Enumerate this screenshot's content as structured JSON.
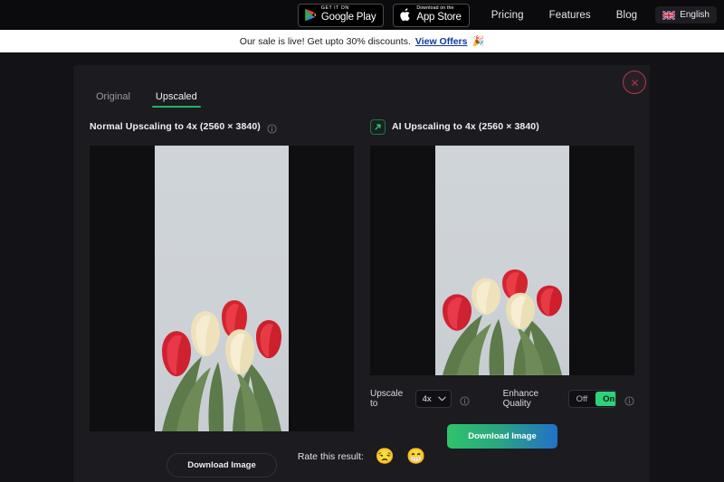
{
  "topnav": {
    "google_play": {
      "small_label": "GET IT ON",
      "main_label": "Google Play",
      "icon": "google-play-icon"
    },
    "app_store": {
      "small_label": "Download on the",
      "main_label": "App Store",
      "icon": "apple-icon"
    },
    "links": [
      {
        "label": "Pricing"
      },
      {
        "label": "Features"
      },
      {
        "label": "Blog"
      }
    ],
    "language": {
      "label": "English",
      "icon": "uk-flag-icon"
    }
  },
  "banner": {
    "text": "Our sale is live! Get upto 30% discounts.",
    "link_label": "View Offers",
    "emoji": "🎉",
    "background": "#ffffff",
    "link_color": "#10379b"
  },
  "modal": {
    "close_icon": "close-icon",
    "close_color": "#b03a54",
    "tabs": [
      {
        "label": "Original",
        "active": false
      },
      {
        "label": "Upscaled",
        "active": true
      }
    ],
    "active_tab_color": "#21b366",
    "left_panel": {
      "title": "Normal Upscaling to 4x (2560 × 3840)",
      "info_icon": "info-icon",
      "download_label": "Download Image"
    },
    "right_panel": {
      "title": "AI Upscaling to 4x (2560 × 3840)",
      "badge_icon": "expand-arrow-icon",
      "info_icon": "info-icon",
      "download_label": "Download Image",
      "controls": {
        "upscale_label": "Upscale to",
        "upscale_value": "4x",
        "upscale_info_icon": "info-icon",
        "enhance_label": "Enhance Quality",
        "enhance_off_label": "Off",
        "enhance_on_label": "On",
        "enhance_state": "On",
        "enhance_info_icon": "info-icon",
        "on_color": "#2fd17b"
      }
    },
    "rating": {
      "label": "Rate this result:",
      "sad_emoji": "😒",
      "happy_emoji": "😁"
    }
  }
}
